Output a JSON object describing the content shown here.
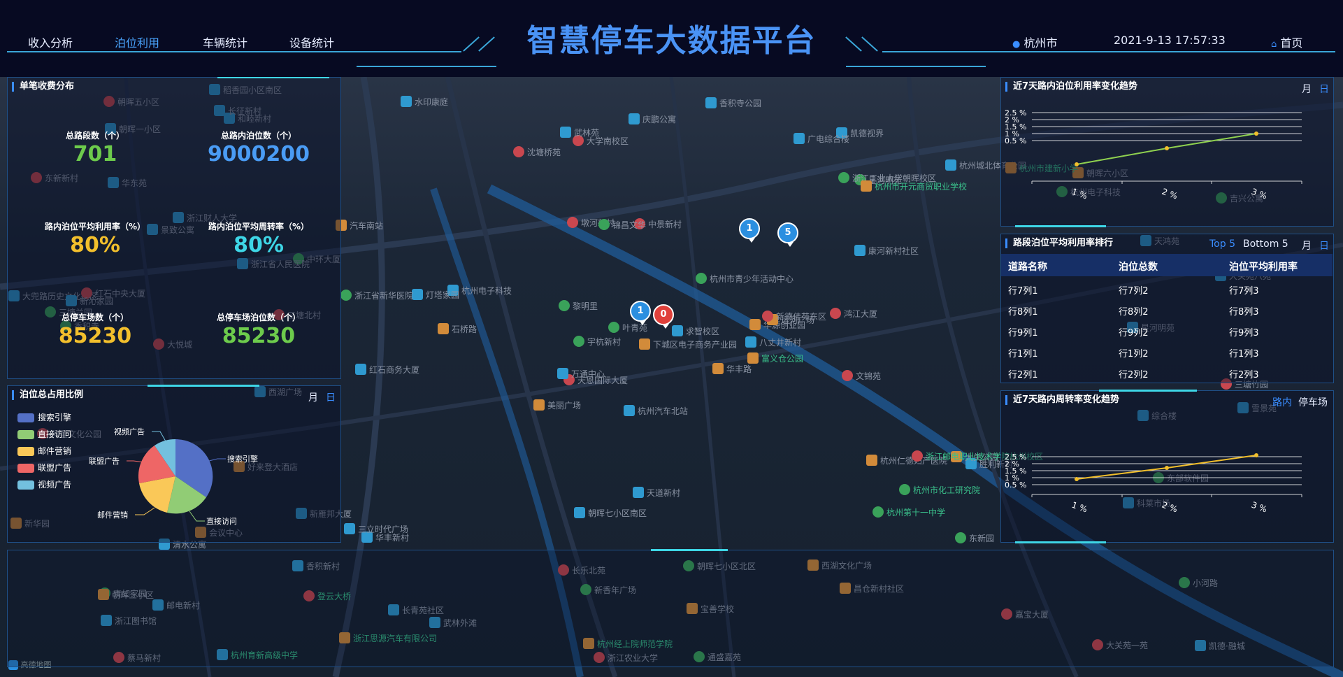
{
  "header": {
    "title": "智慧停车大数据平台",
    "nav": [
      "收入分析",
      "泊位利用",
      "车辆统计",
      "设备统计"
    ],
    "active_nav": "泊位利用",
    "location": "杭州市",
    "datetime": "2021-9-13 17:57:33",
    "home": "首页"
  },
  "fee_panel": {
    "title": "单笔收费分布",
    "stats": [
      {
        "label": "总路段数（个）",
        "value": "701",
        "color": "#6dcb4c"
      },
      {
        "label": "总路内泊位数（个）",
        "value": "9000200",
        "color": "#4a9cf5"
      },
      {
        "label": "路内泊位平均利用率（%）",
        "value": "80%",
        "color": "#f2bf2c"
      },
      {
        "label": "路内泊位平均周转率（%）",
        "value": "80%",
        "color": "#3ed6e6"
      },
      {
        "label": "总停车场数（个）",
        "value": "85230",
        "color": "#f2bf2c"
      },
      {
        "label": "总停车场泊位数（个）",
        "value": "85230",
        "color": "#6dcb4c"
      }
    ]
  },
  "pie_panel": {
    "title": "泊位总占用比例",
    "toggle_month": "月",
    "toggle_day": "日",
    "legend": [
      {
        "name": "搜索引擎",
        "color": "#5470c6"
      },
      {
        "name": "直接访问",
        "color": "#91cc75"
      },
      {
        "name": "邮件营销",
        "color": "#fac858"
      },
      {
        "name": "联盟广告",
        "color": "#ee6666"
      },
      {
        "name": "视频广告",
        "color": "#73c0de"
      }
    ]
  },
  "util_trend": {
    "title": "近7天路内泊位利用率变化趋势",
    "toggle_month": "月",
    "toggle_day": "日"
  },
  "rank_panel": {
    "title": "路段泊位平均利用率排行",
    "top": "Top 5",
    "bottom": "Bottom 5",
    "toggle_month": "月",
    "toggle_day": "日",
    "columns": [
      "道路名称",
      "泊位总数",
      "泊位平均利用率"
    ],
    "rows": [
      [
        "行7列1",
        "行7列2",
        "行7列3"
      ],
      [
        "行8列1",
        "行8列2",
        "行8列3"
      ],
      [
        "行9列1",
        "行9列2",
        "行9列3"
      ],
      [
        "行1列1",
        "行1列2",
        "行1列3"
      ],
      [
        "行2列1",
        "行2列2",
        "行2列3"
      ]
    ]
  },
  "turn_trend": {
    "title": "近7天路内周转率变化趋势",
    "tab_road": "路内",
    "tab_lot": "停车场"
  },
  "map": {
    "bubbles": [
      "1",
      "5",
      "1",
      "0"
    ],
    "footer_label": "高德地图",
    "labels": [
      {
        "t": "杭州汽车北站",
        "g": false
      },
      {
        "t": "景致公寓",
        "g": false
      },
      {
        "t": "天恩国际大厦",
        "g": false
      },
      {
        "t": "吉如家园",
        "g": false
      },
      {
        "t": "华源创业园",
        "g": false
      },
      {
        "t": "华丰新村",
        "g": false
      },
      {
        "t": "凯德视界",
        "g": false
      },
      {
        "t": "中景新村",
        "g": false
      },
      {
        "t": "星河明苑",
        "g": false
      },
      {
        "t": "华丰路",
        "g": false
      },
      {
        "t": "和睦新村",
        "g": false
      },
      {
        "t": "凯德·融城",
        "g": false
      },
      {
        "t": "大悦城",
        "g": false
      },
      {
        "t": "吉兴公寓",
        "g": false
      },
      {
        "t": "美丽广场",
        "g": false
      },
      {
        "t": "康河新村社区",
        "g": false
      },
      {
        "t": "杭州育新高级中学",
        "g": true
      },
      {
        "t": "墩河新村",
        "g": false
      },
      {
        "t": "杭州市青少年活动中心",
        "g": false
      },
      {
        "t": "会议中心",
        "g": false
      },
      {
        "t": "杭州电子科技",
        "g": false
      },
      {
        "t": "浙江图书馆",
        "g": false
      },
      {
        "t": "登云大桥",
        "g": true
      },
      {
        "t": "锦昌文华",
        "g": false
      },
      {
        "t": "运河广场",
        "g": false
      },
      {
        "t": "胜利新村",
        "g": false
      },
      {
        "t": "浙江财人大学",
        "g": false
      },
      {
        "t": "大学南校区",
        "g": false
      },
      {
        "t": "香积寺",
        "g": false
      },
      {
        "t": "杭州仁德妇产医院",
        "g": false
      },
      {
        "t": "大关苑八苑",
        "g": false
      },
      {
        "t": "万通中心",
        "g": false
      },
      {
        "t": "长乐北苑",
        "g": false
      },
      {
        "t": "宇杭新村",
        "g": false
      },
      {
        "t": "汽车南站",
        "g": false
      },
      {
        "t": "杭州城北体育公园",
        "g": false
      },
      {
        "t": "三立时代广场",
        "g": false
      },
      {
        "t": "大关苑一苑",
        "g": false
      },
      {
        "t": "小河路",
        "g": false
      },
      {
        "t": "大关公园",
        "g": false
      },
      {
        "t": "香积寺公园",
        "g": false
      },
      {
        "t": "灯塔家园",
        "g": false
      },
      {
        "t": "三塘北村",
        "g": false
      },
      {
        "t": "杭州第十一中学",
        "g": true
      },
      {
        "t": "浙江思源汽车有限公司",
        "g": true
      },
      {
        "t": "大兜路历史文化街区",
        "g": false
      },
      {
        "t": "八丈井新村",
        "g": false
      },
      {
        "t": "蔡马新村",
        "g": false
      },
      {
        "t": "新香年广场",
        "g": false
      },
      {
        "t": "富义仓公园",
        "g": true
      },
      {
        "t": "清水公寓",
        "g": false
      },
      {
        "t": "天鸿苑",
        "g": false
      },
      {
        "t": "东新新村",
        "g": false
      },
      {
        "t": "杭州市化工研究院",
        "g": true
      },
      {
        "t": "昌仓新村社区",
        "g": false
      },
      {
        "t": "香积新村",
        "g": false
      },
      {
        "t": "长征新村",
        "g": false
      },
      {
        "t": "朝晖五小区",
        "g": false
      },
      {
        "t": "朝晖七小区北区",
        "g": false
      },
      {
        "t": "朝晖六小区",
        "g": false
      },
      {
        "t": "庆鹏公寓",
        "g": false
      },
      {
        "t": "红石商务大厦",
        "g": false
      },
      {
        "t": "红石中央大厦",
        "g": false
      },
      {
        "t": "中环大厦",
        "g": false
      },
      {
        "t": "杭州市建新小学",
        "g": true
      },
      {
        "t": "稻香园小区南区",
        "g": false
      },
      {
        "t": "广电综合楼",
        "g": false
      },
      {
        "t": "沈塘桥苑",
        "g": false
      },
      {
        "t": "叶青苑",
        "g": false
      },
      {
        "t": "新华园",
        "g": false
      },
      {
        "t": "朝晖七小区南区",
        "g": false
      },
      {
        "t": "武林外滩",
        "g": false
      },
      {
        "t": "浙江邮电职业技术学院杭州校区",
        "g": true
      },
      {
        "t": "浙江省新华医院",
        "g": false
      },
      {
        "t": "朝晖三小区",
        "g": false
      },
      {
        "t": "朝晖一小区",
        "g": false
      },
      {
        "t": "浙江省人民医院",
        "g": false
      },
      {
        "t": "阿里文化公园",
        "g": false
      },
      {
        "t": "黎明里",
        "g": false
      },
      {
        "t": "宝善学校",
        "g": false
      },
      {
        "t": "求智校区",
        "g": false
      },
      {
        "t": "邮电新村",
        "g": false
      },
      {
        "t": "文锦苑",
        "g": false
      },
      {
        "t": "东部软件园",
        "g": false
      },
      {
        "t": "杭州经上院师范学院",
        "g": true
      },
      {
        "t": "星河明苑",
        "g": false
      },
      {
        "t": "天道新村",
        "g": false
      },
      {
        "t": "嘉宝大厦",
        "g": false
      },
      {
        "t": "通盛嘉苑",
        "g": false
      },
      {
        "t": "西湖文化广场",
        "g": false
      },
      {
        "t": "武林苑",
        "g": false
      },
      {
        "t": "雪景苑",
        "g": false
      },
      {
        "t": "鸿江大厦",
        "g": false
      },
      {
        "t": "东新园",
        "g": false
      },
      {
        "t": "下城区电子商务产业园",
        "g": false
      },
      {
        "t": "科莱市场",
        "g": false
      },
      {
        "t": "新沁家园",
        "g": false
      },
      {
        "t": "浙江农业大学",
        "g": false
      },
      {
        "t": "浙江工业大学朝晖校区",
        "g": false
      },
      {
        "t": "杭州市开元商贸职业学校",
        "g": true
      },
      {
        "t": "西湖广场",
        "g": false
      },
      {
        "t": "水印康庭",
        "g": false
      },
      {
        "t": "三塘竹园",
        "g": false
      },
      {
        "t": "三塘兰园",
        "g": false
      },
      {
        "t": "好来登大酒店",
        "g": false
      },
      {
        "t": "新雁邦大厦",
        "g": false
      },
      {
        "t": "长青苑社区",
        "g": false
      },
      {
        "t": "新德佳苑东区",
        "g": false
      },
      {
        "t": "杭州电子科技",
        "g": false
      },
      {
        "t": "石桥路",
        "g": false
      },
      {
        "t": "综合楼",
        "g": false
      },
      {
        "t": "华东苑",
        "g": false
      }
    ]
  }
}
